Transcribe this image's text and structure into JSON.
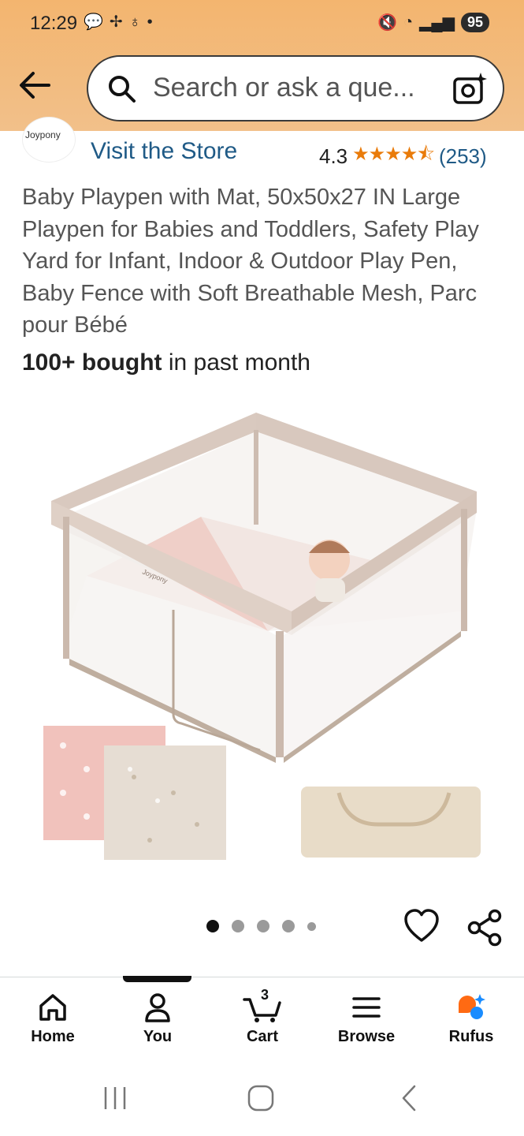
{
  "status_bar": {
    "time": "12:29",
    "left_icons": [
      "chat-bubble-icon",
      "pinwheel-icon",
      "person-icon",
      "dot-icon"
    ],
    "right_icons": [
      "mute-icon",
      "wifi-icon",
      "signal-icon"
    ],
    "battery": "95"
  },
  "search": {
    "placeholder": "Search or ask a que..."
  },
  "store": {
    "logo_text": "Joypony",
    "visit_label": "Visit the Store",
    "rating": "4.3",
    "stars": "★★★★⯪",
    "review_count": "(253)"
  },
  "product": {
    "title": "Baby Playpen with Mat, 50x50x27 IN Large Playpen for Babies and Toddlers, Safety Play Yard for Infant, Indoor & Outdoor Play Pen, Baby Fence with Soft Breathable Mesh, Parc pour Bébé",
    "bought_bold": "100+ bought",
    "bought_rest": " in past month",
    "image_brand": "Joypony"
  },
  "carousel": {
    "count": 5,
    "active_index": 0
  },
  "bottom_nav": {
    "items": [
      {
        "label": "Home"
      },
      {
        "label": "You"
      },
      {
        "label": "Cart"
      },
      {
        "label": "Browse"
      },
      {
        "label": "Rufus"
      }
    ],
    "cart_count": "3"
  },
  "colors": {
    "header": "#f3b56f",
    "link": "#1f5a86",
    "star": "#e97b0a",
    "rufus_orange": "#ff6a13",
    "rufus_blue": "#1a8cff"
  }
}
